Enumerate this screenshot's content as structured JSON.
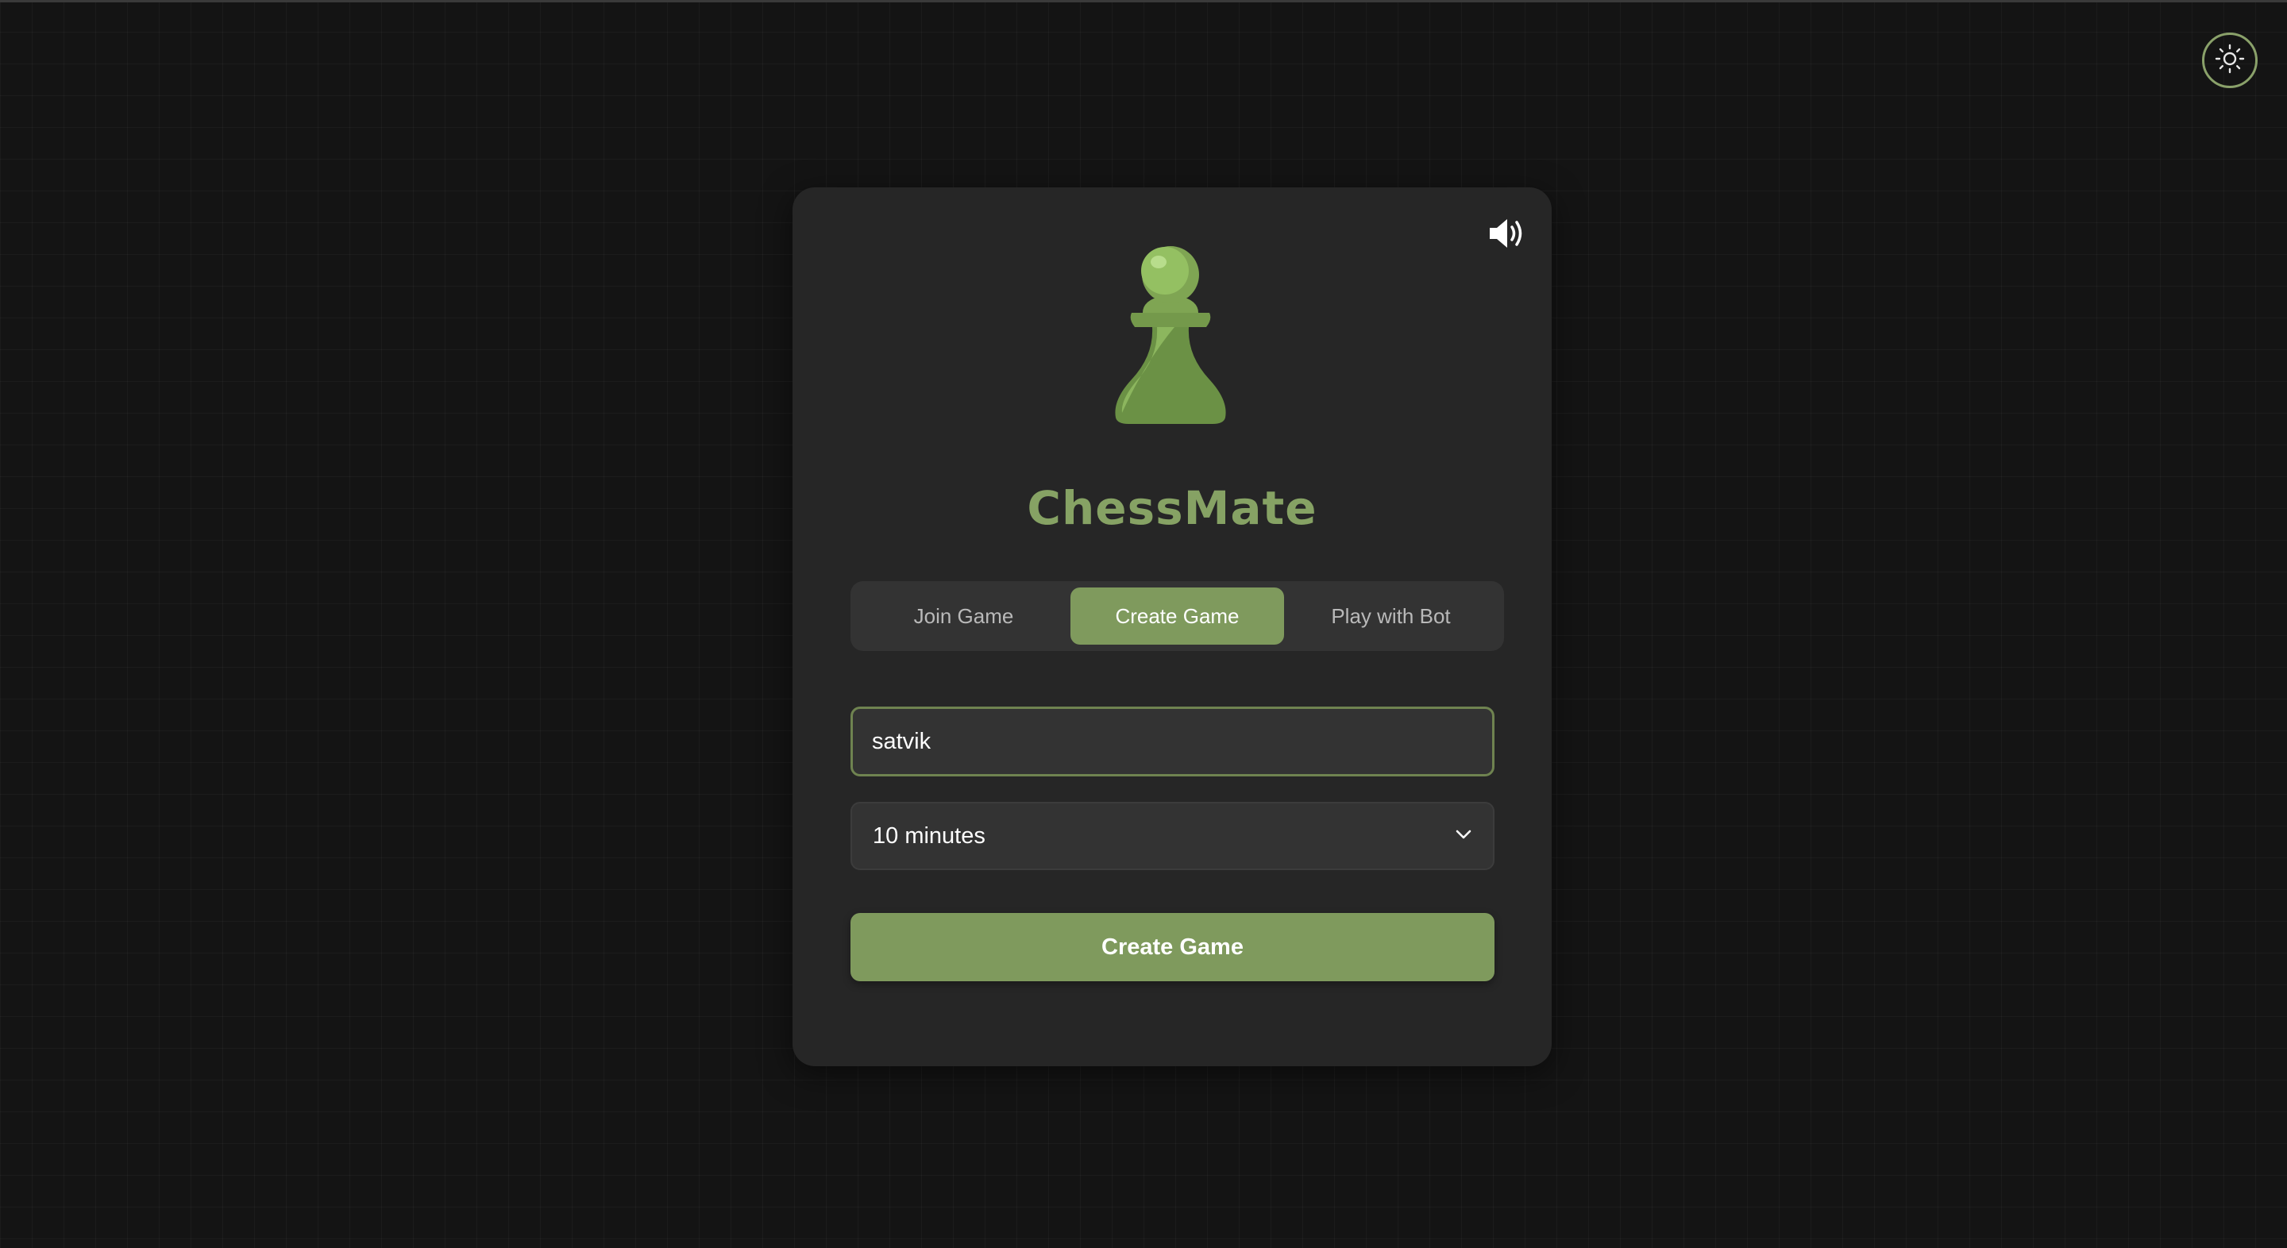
{
  "app": {
    "title": "ChessMate"
  },
  "theme_toggle": {
    "icon": "sun-icon"
  },
  "sound": {
    "icon": "speaker-volume-icon"
  },
  "logo": {
    "icon": "pawn-icon"
  },
  "tabs": [
    {
      "label": "Join Game",
      "active": false
    },
    {
      "label": "Create Game",
      "active": true
    },
    {
      "label": "Play with Bot",
      "active": false
    }
  ],
  "form": {
    "name_value": "satvik",
    "time_control": {
      "selected": "10 minutes",
      "icon": "chevron-down-icon"
    },
    "submit_label": "Create Game"
  },
  "colors": {
    "accent": "#7f9a5d",
    "title": "#86a264",
    "background": "#141414",
    "card": "#262626"
  }
}
